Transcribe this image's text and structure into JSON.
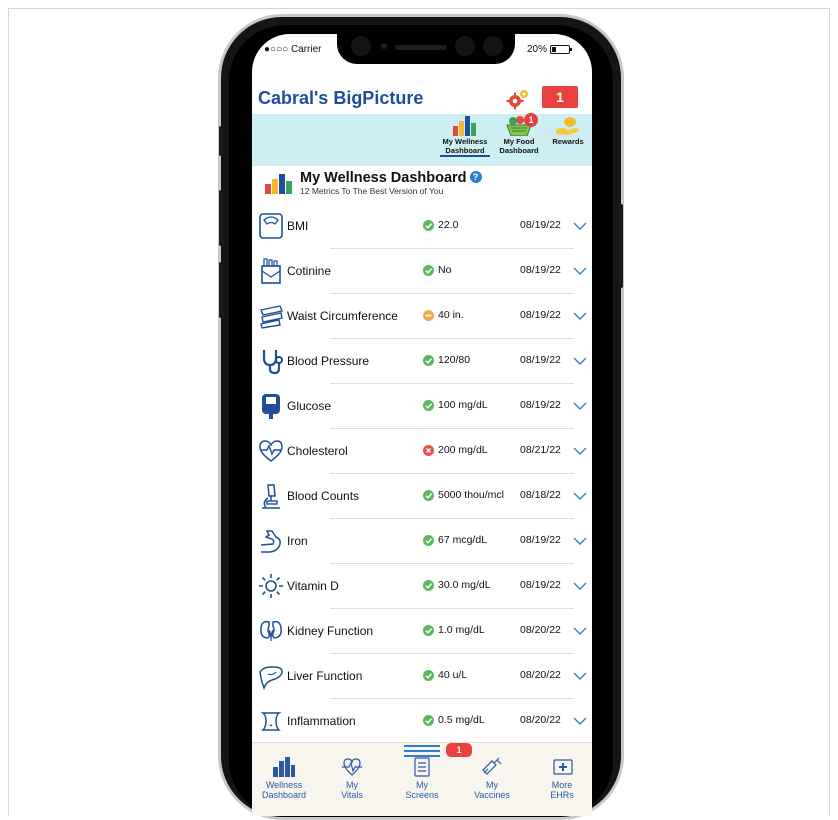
{
  "status_bar": {
    "carrier": "●○○○ Carrier",
    "battery": "20%"
  },
  "header": {
    "title": "Cabral's BigPicture",
    "notification_count": "1"
  },
  "top_nav": {
    "tabs": [
      {
        "label_line1": "My Wellness",
        "label_line2": "Dashboard",
        "active": true
      },
      {
        "label_line1": "My Food",
        "label_line2": "Dashboard",
        "badge": "1"
      },
      {
        "label_line1": "Rewards",
        "label_line2": ""
      }
    ]
  },
  "dashboard": {
    "title": "My Wellness Dashboard",
    "subtitle": "12 Metrics To The Best Version of You",
    "help_icon": "?",
    "metrics": [
      {
        "name": "BMI",
        "value": "22.0",
        "status": "good",
        "date": "08/19/22",
        "icon": "scale-icon"
      },
      {
        "name": "Cotinine",
        "value": "No",
        "status": "good",
        "date": "08/19/22",
        "icon": "cigarette-pack-icon"
      },
      {
        "name": "Waist Circumference",
        "value": "40 in.",
        "status": "warn",
        "date": "08/19/22",
        "icon": "tape-measure-icon"
      },
      {
        "name": "Blood Pressure",
        "value": "120/80",
        "status": "good",
        "date": "08/19/22",
        "icon": "stethoscope-icon"
      },
      {
        "name": "Glucose",
        "value": "100 mg/dL",
        "status": "good",
        "date": "08/19/22",
        "icon": "glucometer-icon"
      },
      {
        "name": "Cholesterol",
        "value": "200 mg/dL",
        "status": "bad",
        "date": "08/21/22",
        "icon": "heartbeat-icon"
      },
      {
        "name": "Blood Counts",
        "value": "5000 thou/mcl",
        "status": "good",
        "date": "08/18/22",
        "icon": "microscope-icon"
      },
      {
        "name": "Iron",
        "value": "67 mcg/dL",
        "status": "good",
        "date": "08/19/22",
        "icon": "flexed-arm-icon"
      },
      {
        "name": "Vitamin D",
        "value": "30.0 mg/dL",
        "status": "good",
        "date": "08/19/22",
        "icon": "sun-icon"
      },
      {
        "name": "Kidney Function",
        "value": "1.0 mg/dL",
        "status": "good",
        "date": "08/20/22",
        "icon": "kidneys-icon"
      },
      {
        "name": "Liver Function",
        "value": "40 u/L",
        "status": "good",
        "date": "08/20/22",
        "icon": "liver-icon"
      },
      {
        "name": "Inflammation",
        "value": "0.5 mg/dL",
        "status": "good",
        "date": "08/20/22",
        "icon": "inflammation-icon"
      }
    ]
  },
  "bottom_nav": {
    "badge": "1",
    "items": [
      {
        "line1": "Wellness",
        "line2": "Dashboard"
      },
      {
        "line1": "My",
        "line2": "Vitals"
      },
      {
        "line1": "My",
        "line2": "Screens"
      },
      {
        "line1": "My",
        "line2": "Vaccines"
      },
      {
        "line1": "More",
        "line2": "EHRs"
      }
    ]
  },
  "colors": {
    "brand": "#1d4f9a",
    "accent_band": "#cdeff4",
    "alert": "#e8413f",
    "good": "#5cb85c",
    "warn": "#f0ad4e",
    "bad": "#e85050"
  }
}
